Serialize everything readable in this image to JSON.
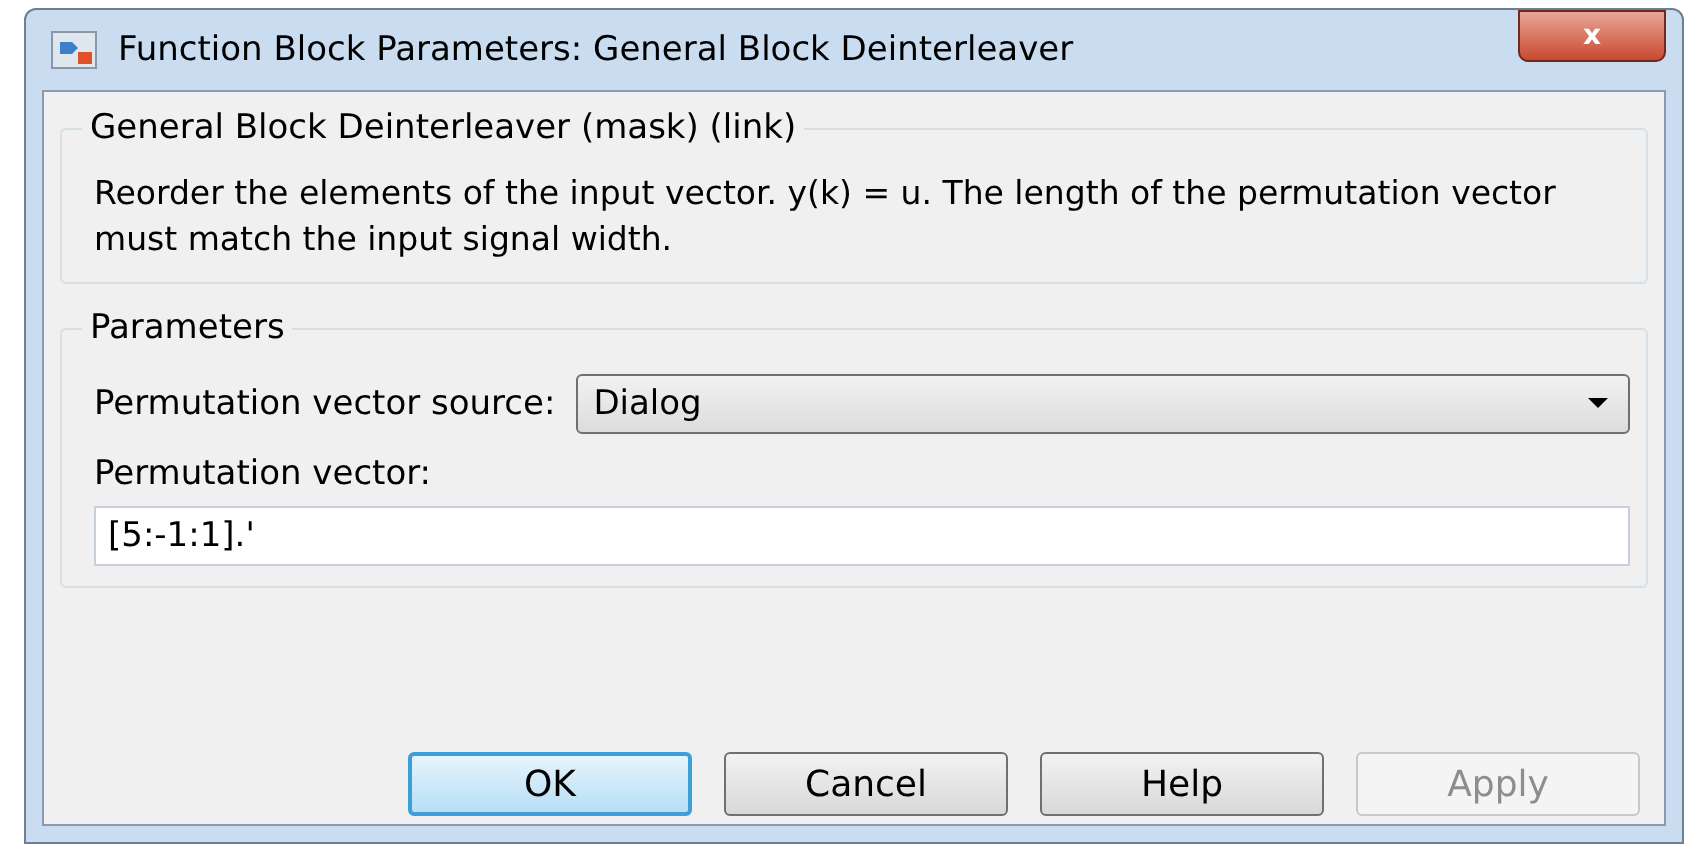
{
  "window": {
    "title": "Function Block Parameters: General Block Deinterleaver",
    "close": "x"
  },
  "description": {
    "title": "General Block Deinterleaver (mask) (link)",
    "text": "Reorder the elements of the input vector. y(k) = u.  The length of the permutation vector must match the input signal width."
  },
  "parameters": {
    "title": "Parameters",
    "source_label": "Permutation vector source:",
    "source_value": "Dialog",
    "vector_label": "Permutation vector:",
    "vector_value": "[5:-1:1].'"
  },
  "buttons": [
    {
      "label": "OK",
      "default": true,
      "disabled": false
    },
    {
      "label": "Cancel",
      "default": false,
      "disabled": false
    },
    {
      "label": "Help",
      "default": false,
      "disabled": false
    },
    {
      "label": "Apply",
      "default": false,
      "disabled": true
    }
  ]
}
